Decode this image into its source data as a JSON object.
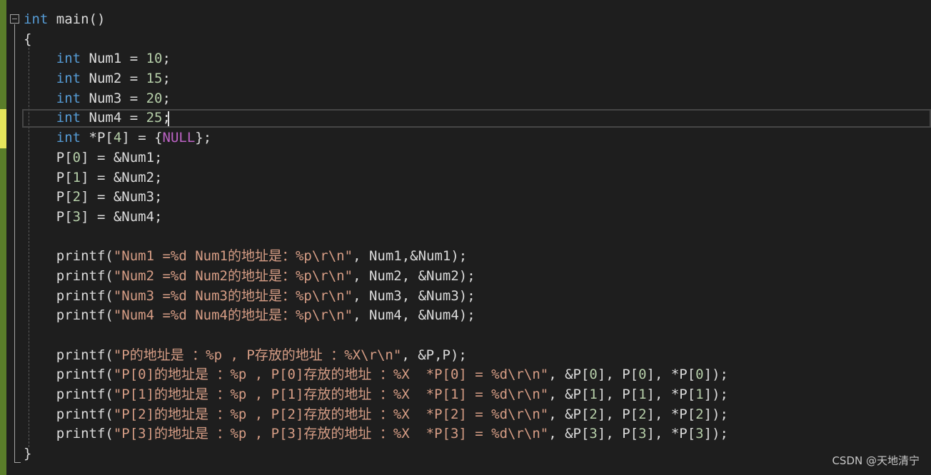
{
  "editor": {
    "language": "c",
    "fold_toggle_glyph": "−",
    "current_line_index": 5,
    "theme_colors": {
      "background": "#1e1e1e",
      "keyword": "#569cd6",
      "number": "#b5cea8",
      "string": "#d69d85",
      "macro": "#bd63c5",
      "text": "#dcdcdc",
      "change_saved": "#5a7d2a",
      "change_unsaved": "#e6e65c"
    },
    "lines": [
      [
        {
          "t": "kw",
          "v": "int"
        },
        {
          "t": "plain",
          "v": " main()"
        }
      ],
      [
        {
          "t": "plain",
          "v": "{"
        }
      ],
      [
        {
          "t": "plain",
          "v": "    "
        },
        {
          "t": "kw",
          "v": "int"
        },
        {
          "t": "plain",
          "v": " Num1 = "
        },
        {
          "t": "num",
          "v": "10"
        },
        {
          "t": "plain",
          "v": ";"
        }
      ],
      [
        {
          "t": "plain",
          "v": "    "
        },
        {
          "t": "kw",
          "v": "int"
        },
        {
          "t": "plain",
          "v": " Num2 = "
        },
        {
          "t": "num",
          "v": "15"
        },
        {
          "t": "plain",
          "v": ";"
        }
      ],
      [
        {
          "t": "plain",
          "v": "    "
        },
        {
          "t": "kw",
          "v": "int"
        },
        {
          "t": "plain",
          "v": " Num3 = "
        },
        {
          "t": "num",
          "v": "20"
        },
        {
          "t": "plain",
          "v": ";"
        }
      ],
      [
        {
          "t": "plain",
          "v": "    "
        },
        {
          "t": "kw",
          "v": "int"
        },
        {
          "t": "plain",
          "v": " Num4 = "
        },
        {
          "t": "num",
          "v": "25"
        },
        {
          "t": "plain",
          "v": ";"
        }
      ],
      [
        {
          "t": "plain",
          "v": "    "
        },
        {
          "t": "kw",
          "v": "int"
        },
        {
          "t": "plain",
          "v": " *P["
        },
        {
          "t": "num",
          "v": "4"
        },
        {
          "t": "plain",
          "v": "] = {"
        },
        {
          "t": "macro",
          "v": "NULL"
        },
        {
          "t": "plain",
          "v": "};"
        }
      ],
      [
        {
          "t": "plain",
          "v": "    P["
        },
        {
          "t": "num",
          "v": "0"
        },
        {
          "t": "plain",
          "v": "] = &Num1;"
        }
      ],
      [
        {
          "t": "plain",
          "v": "    P["
        },
        {
          "t": "num",
          "v": "1"
        },
        {
          "t": "plain",
          "v": "] = &Num2;"
        }
      ],
      [
        {
          "t": "plain",
          "v": "    P["
        },
        {
          "t": "num",
          "v": "2"
        },
        {
          "t": "plain",
          "v": "] = &Num3;"
        }
      ],
      [
        {
          "t": "plain",
          "v": "    P["
        },
        {
          "t": "num",
          "v": "3"
        },
        {
          "t": "plain",
          "v": "] = &Num4;"
        }
      ],
      [
        {
          "t": "plain",
          "v": ""
        }
      ],
      [
        {
          "t": "plain",
          "v": "    printf("
        },
        {
          "t": "str",
          "v": "\"Num1 =%d Num1的地址是：%p\\r\\n\""
        },
        {
          "t": "plain",
          "v": ", Num1,&Num1);"
        }
      ],
      [
        {
          "t": "plain",
          "v": "    printf("
        },
        {
          "t": "str",
          "v": "\"Num2 =%d Num2的地址是：%p\\r\\n\""
        },
        {
          "t": "plain",
          "v": ", Num2, &Num2);"
        }
      ],
      [
        {
          "t": "plain",
          "v": "    printf("
        },
        {
          "t": "str",
          "v": "\"Num3 =%d Num3的地址是：%p\\r\\n\""
        },
        {
          "t": "plain",
          "v": ", Num3, &Num3);"
        }
      ],
      [
        {
          "t": "plain",
          "v": "    printf("
        },
        {
          "t": "str",
          "v": "\"Num4 =%d Num4的地址是：%p\\r\\n\""
        },
        {
          "t": "plain",
          "v": ", Num4, &Num4);"
        }
      ],
      [
        {
          "t": "plain",
          "v": ""
        }
      ],
      [
        {
          "t": "plain",
          "v": "    printf("
        },
        {
          "t": "str",
          "v": "\"P的地址是 ：%p , P存放的地址 ：%X\\r\\n\""
        },
        {
          "t": "plain",
          "v": ", &P,P);"
        }
      ],
      [
        {
          "t": "plain",
          "v": "    printf("
        },
        {
          "t": "str",
          "v": "\"P[0]的地址是 ：%p , P[0]存放的地址 ：%X  *P[0] = %d\\r\\n\""
        },
        {
          "t": "plain",
          "v": ", &P["
        },
        {
          "t": "num",
          "v": "0"
        },
        {
          "t": "plain",
          "v": "], P["
        },
        {
          "t": "num",
          "v": "0"
        },
        {
          "t": "plain",
          "v": "], *P["
        },
        {
          "t": "num",
          "v": "0"
        },
        {
          "t": "plain",
          "v": "]);"
        }
      ],
      [
        {
          "t": "plain",
          "v": "    printf("
        },
        {
          "t": "str",
          "v": "\"P[1]的地址是 ：%p , P[1]存放的地址 ：%X  *P[1] = %d\\r\\n\""
        },
        {
          "t": "plain",
          "v": ", &P["
        },
        {
          "t": "num",
          "v": "1"
        },
        {
          "t": "plain",
          "v": "], P["
        },
        {
          "t": "num",
          "v": "1"
        },
        {
          "t": "plain",
          "v": "], *P["
        },
        {
          "t": "num",
          "v": "1"
        },
        {
          "t": "plain",
          "v": "]);"
        }
      ],
      [
        {
          "t": "plain",
          "v": "    printf("
        },
        {
          "t": "str",
          "v": "\"P[2]的地址是 ：%p , P[2]存放的地址 ：%X  *P[2] = %d\\r\\n\""
        },
        {
          "t": "plain",
          "v": ", &P["
        },
        {
          "t": "num",
          "v": "2"
        },
        {
          "t": "plain",
          "v": "], P["
        },
        {
          "t": "num",
          "v": "2"
        },
        {
          "t": "plain",
          "v": "], *P["
        },
        {
          "t": "num",
          "v": "2"
        },
        {
          "t": "plain",
          "v": "]);"
        }
      ],
      [
        {
          "t": "plain",
          "v": "    printf("
        },
        {
          "t": "str",
          "v": "\"P[3]的地址是 ：%p , P[3]存放的地址 ：%X  *P[3] = %d\\r\\n\""
        },
        {
          "t": "plain",
          "v": ", &P["
        },
        {
          "t": "num",
          "v": "3"
        },
        {
          "t": "plain",
          "v": "], P["
        },
        {
          "t": "num",
          "v": "3"
        },
        {
          "t": "plain",
          "v": "], *P["
        },
        {
          "t": "num",
          "v": "3"
        },
        {
          "t": "plain",
          "v": "]);"
        }
      ],
      [
        {
          "t": "plain",
          "v": "}"
        }
      ]
    ]
  },
  "watermark": {
    "text": "CSDN @天地清宁"
  }
}
